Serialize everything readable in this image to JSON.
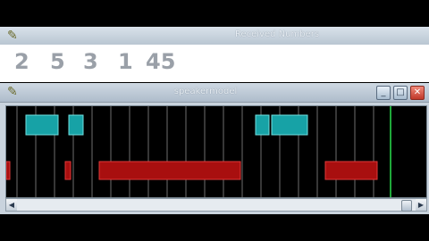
{
  "received_window": {
    "title": "Received Numbers",
    "numbers": [
      "2",
      "5",
      "3",
      "1",
      "45"
    ]
  },
  "speaker_window": {
    "title": "speakermodel",
    "controls": {
      "minimize": "_",
      "maximize": "□",
      "close": "✕"
    }
  },
  "scrollbar": {
    "left_arrow": "◀",
    "right_arrow": "▶"
  },
  "colors": {
    "cyan_segment": "#17a2a6",
    "red_segment": "#b01010",
    "grid_line": "#7a7a7a",
    "cursor_line": "#1fa83a"
  }
}
